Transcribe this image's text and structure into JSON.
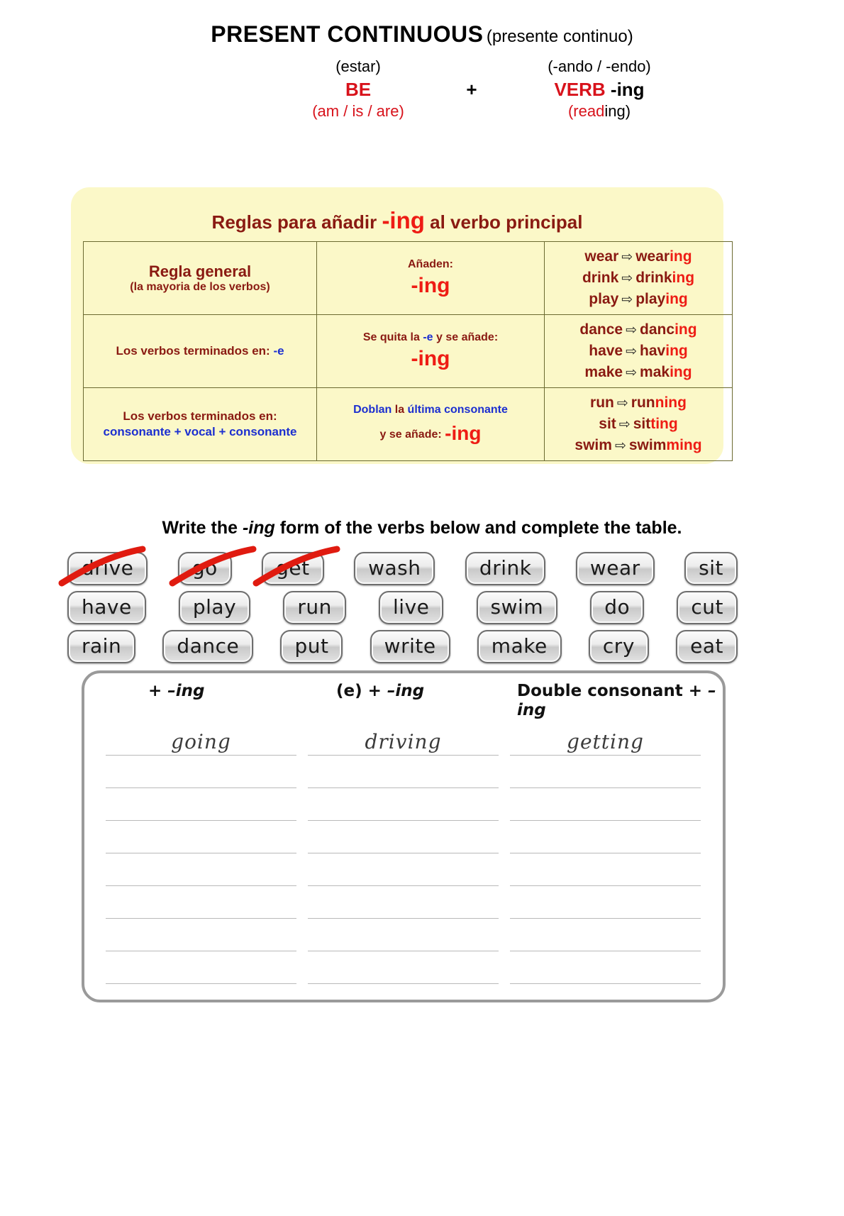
{
  "header": {
    "title_main": "PRESENT CONTINUOUS",
    "title_sub": "(presente continuo)",
    "formula": {
      "estar": "(estar)",
      "be": "BE",
      "am_is_are_open": "(",
      "am": "am",
      "slash1": " / ",
      "is": "is",
      "slash2": " / ",
      "are": "are",
      "am_is_are_close": ")",
      "plus": "+",
      "ando_endo": "(-ando / -endo)",
      "verb": "VERB",
      "verb_ing": " -ing",
      "reading_open": "(",
      "reading_red": "read",
      "reading_black": "ing)"
    }
  },
  "rules": {
    "title_prefix": "Reglas para añadir ",
    "title_ing": "-ing",
    "title_suffix": " al verbo principal",
    "rows": [
      {
        "rule_title": "Regla general",
        "rule_sub": "(la mayoria de los verbos)",
        "action_text": "Añaden:",
        "action_ing": "-ing",
        "examples": [
          {
            "base": "wear",
            "arrow": "⇨",
            "stem": "wear",
            "ing": "ing"
          },
          {
            "base": "drink",
            "arrow": "⇨",
            "stem": "drink",
            "ing": "ing"
          },
          {
            "base": "play",
            "arrow": "⇨",
            "stem": "play",
            "ing": "ing"
          }
        ]
      },
      {
        "rule_title": "Los verbos terminados en: ",
        "rule_highlight": "-e",
        "action_pre": "Se quita la ",
        "action_e": "-e",
        "action_post": " y se añade:",
        "action_ing": "-ing",
        "examples": [
          {
            "base": "dance",
            "arrow": "⇨",
            "stem": "danc",
            "ing": "ing"
          },
          {
            "base": "have",
            "arrow": "⇨",
            "stem": "hav",
            "ing": "ing"
          },
          {
            "base": "make",
            "arrow": "⇨",
            "stem": "mak",
            "ing": "ing"
          }
        ]
      },
      {
        "rule_title": "Los verbos terminados en:",
        "rule_sub_blue": "consonante + vocal + consonante",
        "action_doblan": "Doblan",
        "action_la": " la ",
        "action_rest": "última consonante",
        "action_y": "y se añade: ",
        "action_ing": "-ing",
        "examples": [
          {
            "base": "run",
            "arrow": "⇨",
            "stem": "run",
            "ing": "ning"
          },
          {
            "base": "sit",
            "arrow": "⇨",
            "stem": "sit",
            "ing": "ting"
          },
          {
            "base": "swim",
            "arrow": "⇨",
            "stem": "swim",
            "ing": "ming"
          }
        ]
      }
    ]
  },
  "exercise": {
    "instruction_pre": "Write  the ",
    "instruction_ing": "-ing",
    "instruction_post": " form of the verbs below and complete the table.",
    "verb_rows": [
      [
        {
          "label": "drive",
          "struck": true
        },
        {
          "label": "go",
          "struck": true
        },
        {
          "label": "get",
          "struck": true
        },
        {
          "label": "wash",
          "struck": false
        },
        {
          "label": "drink",
          "struck": false
        },
        {
          "label": "wear",
          "struck": false
        },
        {
          "label": "sit",
          "struck": false
        }
      ],
      [
        {
          "label": "have",
          "struck": false
        },
        {
          "label": "play",
          "struck": false
        },
        {
          "label": "run",
          "struck": false
        },
        {
          "label": "live",
          "struck": false
        },
        {
          "label": "swim",
          "struck": false
        },
        {
          "label": "do",
          "struck": false
        },
        {
          "label": "cut",
          "struck": false
        }
      ],
      [
        {
          "label": "rain",
          "struck": false
        },
        {
          "label": "dance",
          "struck": false
        },
        {
          "label": "put",
          "struck": false
        },
        {
          "label": "write",
          "struck": false
        },
        {
          "label": "make",
          "struck": false
        },
        {
          "label": "cry",
          "struck": false
        },
        {
          "label": "eat",
          "struck": false
        }
      ]
    ]
  },
  "answer_table": {
    "headers": [
      {
        "plain": "+ ",
        "ital": "–ing",
        "plain2": ""
      },
      {
        "plain": "(e) + ",
        "ital": "–ing",
        "plain2": ""
      },
      {
        "plain": "Double consonant + ",
        "ital": "–ing",
        "plain2": ""
      }
    ],
    "columns": [
      {
        "answers": [
          "going",
          "",
          "",
          "",
          "",
          "",
          "",
          ""
        ]
      },
      {
        "answers": [
          "driving",
          "",
          "",
          "",
          "",
          "",
          "",
          ""
        ]
      },
      {
        "answers": [
          "getting",
          "",
          "",
          "",
          "",
          "",
          "",
          ""
        ]
      }
    ]
  },
  "colors": {
    "bright_red": "#ee1c14",
    "dark_red": "#8a1a12",
    "blue": "#1c2fd0",
    "yellow_box": "#fbf8c8",
    "strike_red": "#e01b10"
  }
}
